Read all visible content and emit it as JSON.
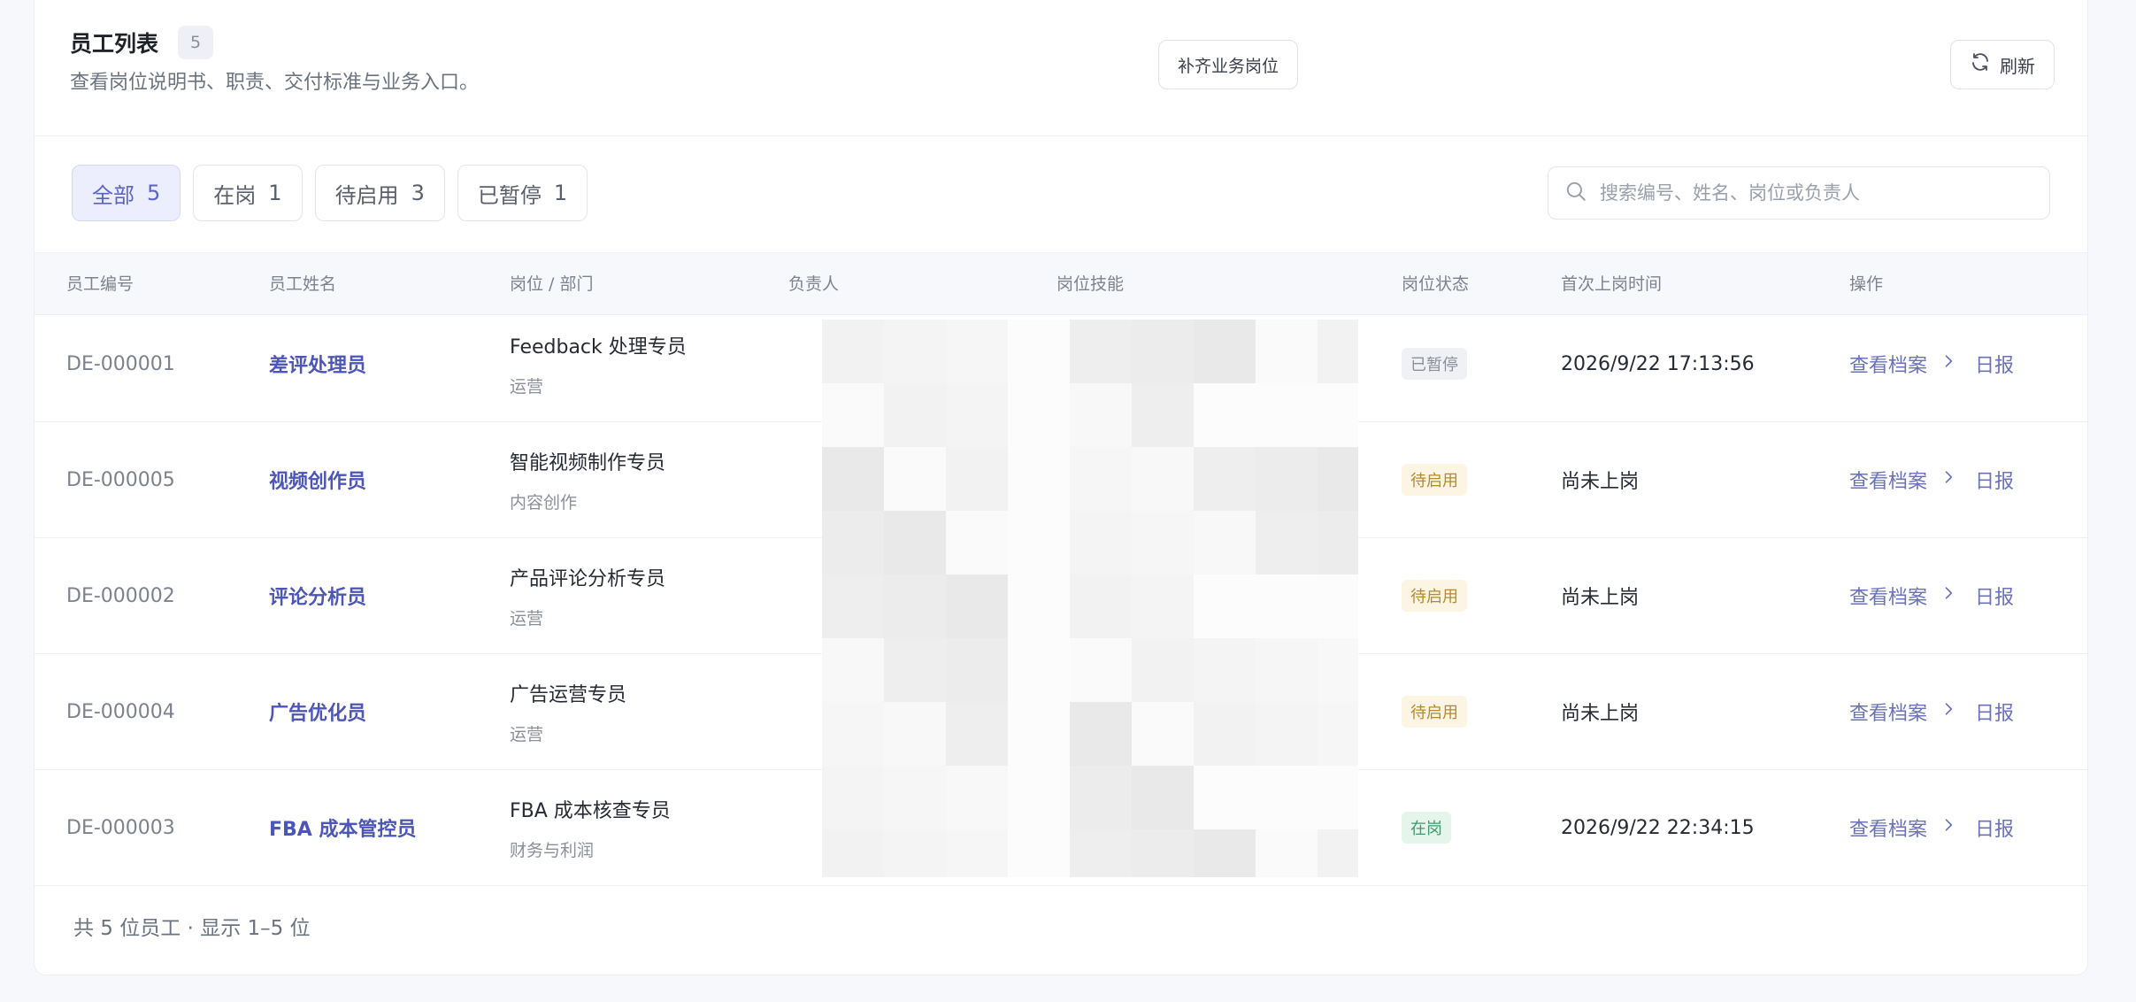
{
  "header": {
    "title": "员工列表",
    "count": "5",
    "subtitle": "查看岗位说明书、职责、交付标准与业务入口。",
    "supplement_label": "补齐业务岗位",
    "refresh_label": "刷新"
  },
  "tabs": [
    {
      "label": "全部",
      "count": "5",
      "active": true
    },
    {
      "label": "在岗",
      "count": "1",
      "active": false
    },
    {
      "label": "待启用",
      "count": "3",
      "active": false
    },
    {
      "label": "已暂停",
      "count": "1",
      "active": false
    }
  ],
  "search": {
    "placeholder": "搜索编号、姓名、岗位或负责人",
    "value": ""
  },
  "columns": [
    "员工编号",
    "员工姓名",
    "岗位 / 部门",
    "负责人",
    "岗位技能",
    "岗位状态",
    "首次上岗时间",
    "操作"
  ],
  "rows": [
    {
      "id": "DE-000001",
      "name": "差评处理员",
      "position": "Feedback 处理专员",
      "dept": "运营",
      "status": "已暂停",
      "status_color": "#8a8f9a",
      "status_bg": "#f0f1f4",
      "first_time": "2026/9/22 17:13:56",
      "view_label": "查看档案",
      "report_label": "日报"
    },
    {
      "id": "DE-000005",
      "name": "视频创作员",
      "position": "智能视频制作专员",
      "dept": "内容创作",
      "status": "待启用",
      "status_color": "#b58a2b",
      "status_bg": "#fdf5e4",
      "first_time": "尚未上岗",
      "view_label": "查看档案",
      "report_label": "日报"
    },
    {
      "id": "DE-000002",
      "name": "评论分析员",
      "position": "产品评论分析专员",
      "dept": "运营",
      "status": "待启用",
      "status_color": "#b58a2b",
      "status_bg": "#fdf5e4",
      "first_time": "尚未上岗",
      "view_label": "查看档案",
      "report_label": "日报"
    },
    {
      "id": "DE-000004",
      "name": "广告优化员",
      "position": "广告运营专员",
      "dept": "运营",
      "status": "待启用",
      "status_color": "#b58a2b",
      "status_bg": "#fdf5e4",
      "first_time": "尚未上岗",
      "view_label": "查看档案",
      "report_label": "日报"
    },
    {
      "id": "DE-000003",
      "name": "FBA 成本管控员",
      "position": "FBA 成本核查专员",
      "dept": "财务与利润",
      "status": "在岗",
      "status_color": "#3f9a6b",
      "status_bg": "#e6f5ec",
      "first_time": "2026/9/22 22:34:15",
      "view_label": "查看档案",
      "report_label": "日报"
    }
  ],
  "footer": {
    "summary": "共 5 位员工 · 显示 1–5 位"
  },
  "icons": {
    "refresh": "refresh-icon",
    "search": "search-icon",
    "chevron": "chevron-right-icon"
  }
}
